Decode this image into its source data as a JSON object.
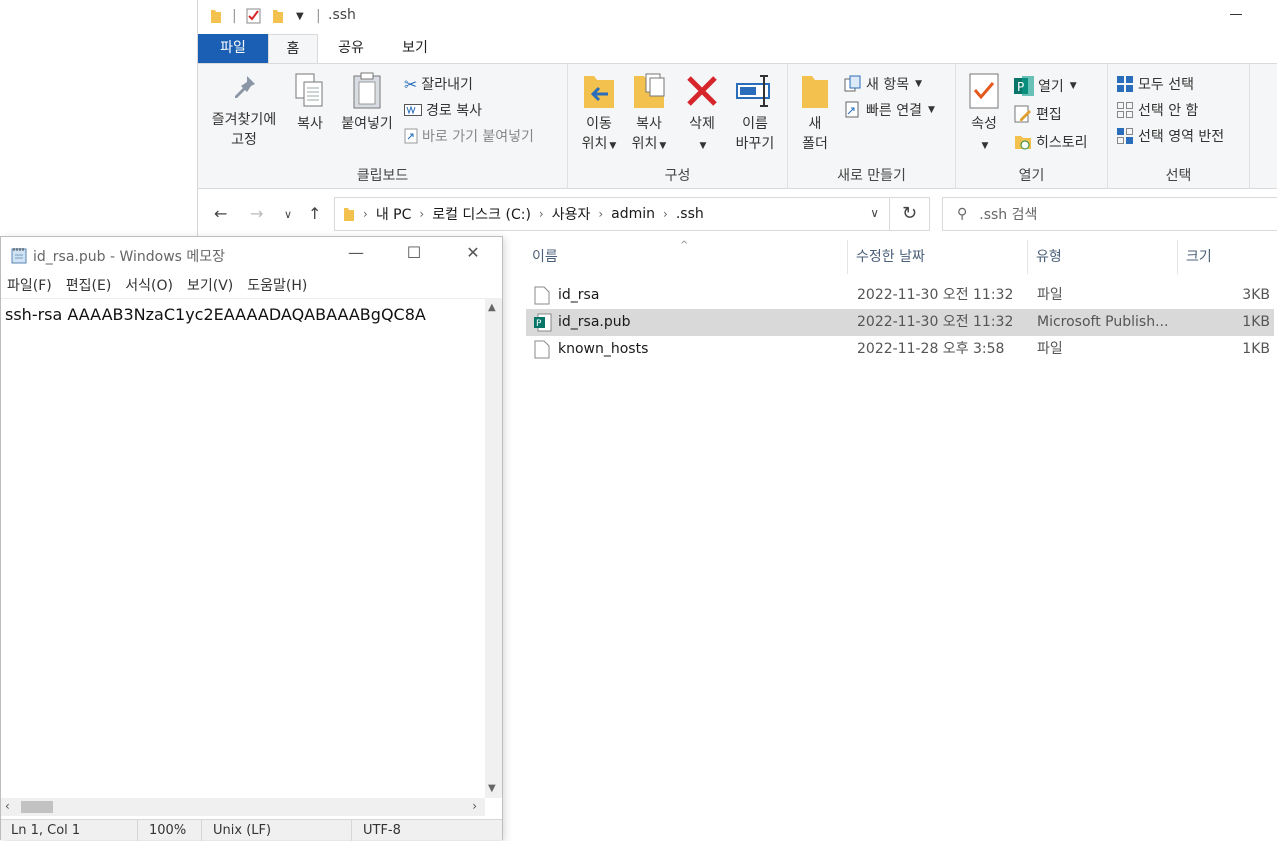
{
  "explorer": {
    "window_title": ".ssh",
    "tabs": [
      "파일",
      "홈",
      "공유",
      "보기"
    ],
    "ribbon": {
      "clipboard": {
        "pin_line1": "즐겨찾기에",
        "pin_line2": "고정",
        "copy": "복사",
        "paste": "붙여넣기",
        "cut": "잘라내기",
        "copy_path": "경로 복사",
        "paste_shortcut": "바로 가기 붙여넣기",
        "label": "클립보드"
      },
      "organize": {
        "move_line1": "이동",
        "move_line2": "위치",
        "copyto_line1": "복사",
        "copyto_line2": "위치",
        "delete": "삭제",
        "rename_line1": "이름",
        "rename_line2": "바꾸기",
        "label": "구성"
      },
      "new": {
        "folder_line1": "새",
        "folder_line2": "폴더",
        "new_item": "새 항목",
        "easy_access": "빠른 연결",
        "label": "새로 만들기"
      },
      "open": {
        "properties": "속성",
        "open": "열기",
        "edit": "편집",
        "history": "히스토리",
        "label": "열기"
      },
      "select": {
        "select_all": "모두 선택",
        "select_none": "선택 안 함",
        "invert": "선택 영역 반전",
        "label": "선택"
      }
    },
    "breadcrumb": [
      "내 PC",
      "로컬 디스크 (C:)",
      "사용자",
      "admin",
      ".ssh"
    ],
    "search_placeholder": ".ssh 검색",
    "columns": [
      "이름",
      "수정한 날짜",
      "유형",
      "크기"
    ],
    "files": [
      {
        "name": "id_rsa",
        "date": "2022-11-30 오전 11:32",
        "type": "파일",
        "size": "3KB"
      },
      {
        "name": "id_rsa.pub",
        "date": "2022-11-30 오전 11:32",
        "type": "Microsoft Publish...",
        "size": "1KB"
      },
      {
        "name": "known_hosts",
        "date": "2022-11-28 오후 3:58",
        "type": "파일",
        "size": "1KB"
      }
    ]
  },
  "notepad": {
    "title": "id_rsa.pub - Windows 메모장",
    "menu": [
      "파일(F)",
      "편집(E)",
      "서식(O)",
      "보기(V)",
      "도움말(H)"
    ],
    "content": "ssh-rsa AAAAB3NzaC1yc2EAAAADAQABAAABgQC8A",
    "status": {
      "position": "Ln 1, Col 1",
      "zoom": "100%",
      "eol": "Unix (LF)",
      "encoding": "UTF-8"
    }
  },
  "colors": {
    "accent": "#1a5fb4",
    "folder": "#f2c14e",
    "delete_red": "#d6262b",
    "selection": "#d9d9d9"
  }
}
